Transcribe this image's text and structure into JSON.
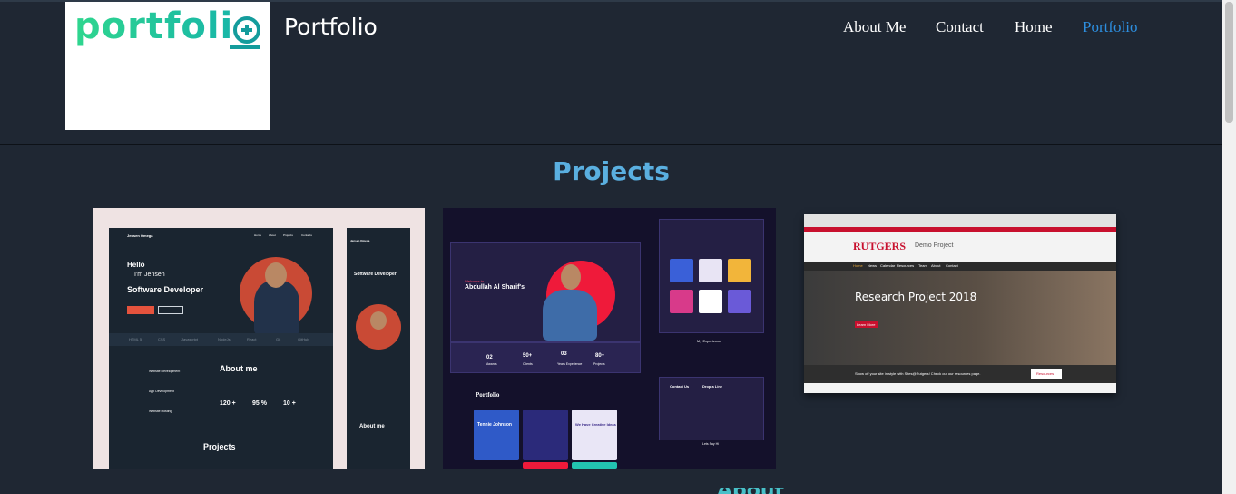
{
  "header": {
    "logo_text": "portfoli",
    "brand_title": "Portfolio",
    "nav": [
      {
        "label": "About Me",
        "active": false
      },
      {
        "label": "Contact",
        "active": false
      },
      {
        "label": "Home",
        "active": false
      },
      {
        "label": "Portfolio",
        "active": true
      }
    ]
  },
  "main": {
    "section_title": "Projects",
    "projects": [
      {
        "thumb": {
          "brand": "Jensen Omega",
          "nav": [
            "Home",
            "About",
            "Projects",
            "Contacts"
          ],
          "hello": "Hello",
          "name": "I'm Jensen",
          "role": "Software Developer",
          "btn_primary": "Hire a project",
          "btn_secondary": "My resume",
          "skills": [
            "HTML 5",
            "CSS",
            "Javascript",
            "NodeJs",
            "React",
            "Git",
            "GitHub"
          ],
          "about_title": "About me",
          "services": [
            "Website Development",
            "App Development",
            "Website Hosting"
          ],
          "stats": [
            "120 +",
            "95 %",
            "10 +"
          ],
          "projects_title": "Projects"
        }
      },
      {
        "thumb": {
          "welcome": "Welcome to",
          "name": "Abdullah Al Sharif's",
          "stats": [
            "02",
            "50+",
            "03",
            "80+"
          ],
          "stat_labels": [
            "Awards",
            "Clients",
            "Years Experience",
            "Projects"
          ],
          "portfolio_title": "Portfolio",
          "tennie": "Tennie Johnson",
          "ideas": "We Have Creative Ideas",
          "experience": "My Experience",
          "contact": "Contact Us",
          "drop": "Drop a Line",
          "follow": "Lets Say Hi"
        }
      },
      {
        "thumb": {
          "brand": "RUTGERS",
          "brand_sub": "Demo Project",
          "nav": [
            "Home",
            "News",
            "Calendar",
            "Resources",
            "Team",
            "About",
            "Contact"
          ],
          "hero_title": "Research Project 2018",
          "hero_btn": "Learn More",
          "footer_text": "Show off your site in style with Sites@Rutgers! Check out our resources page.",
          "footer_btn": "Resources"
        }
      }
    ],
    "next_section_partial": "About"
  },
  "colors": {
    "background": "#1f2733",
    "accent_nav_active": "#2d8fe0",
    "section_title": "#5aafe0",
    "logo_green": "#2fd68e",
    "logo_teal": "#149c9c"
  },
  "icons": [
    "plus-circle-icon"
  ]
}
